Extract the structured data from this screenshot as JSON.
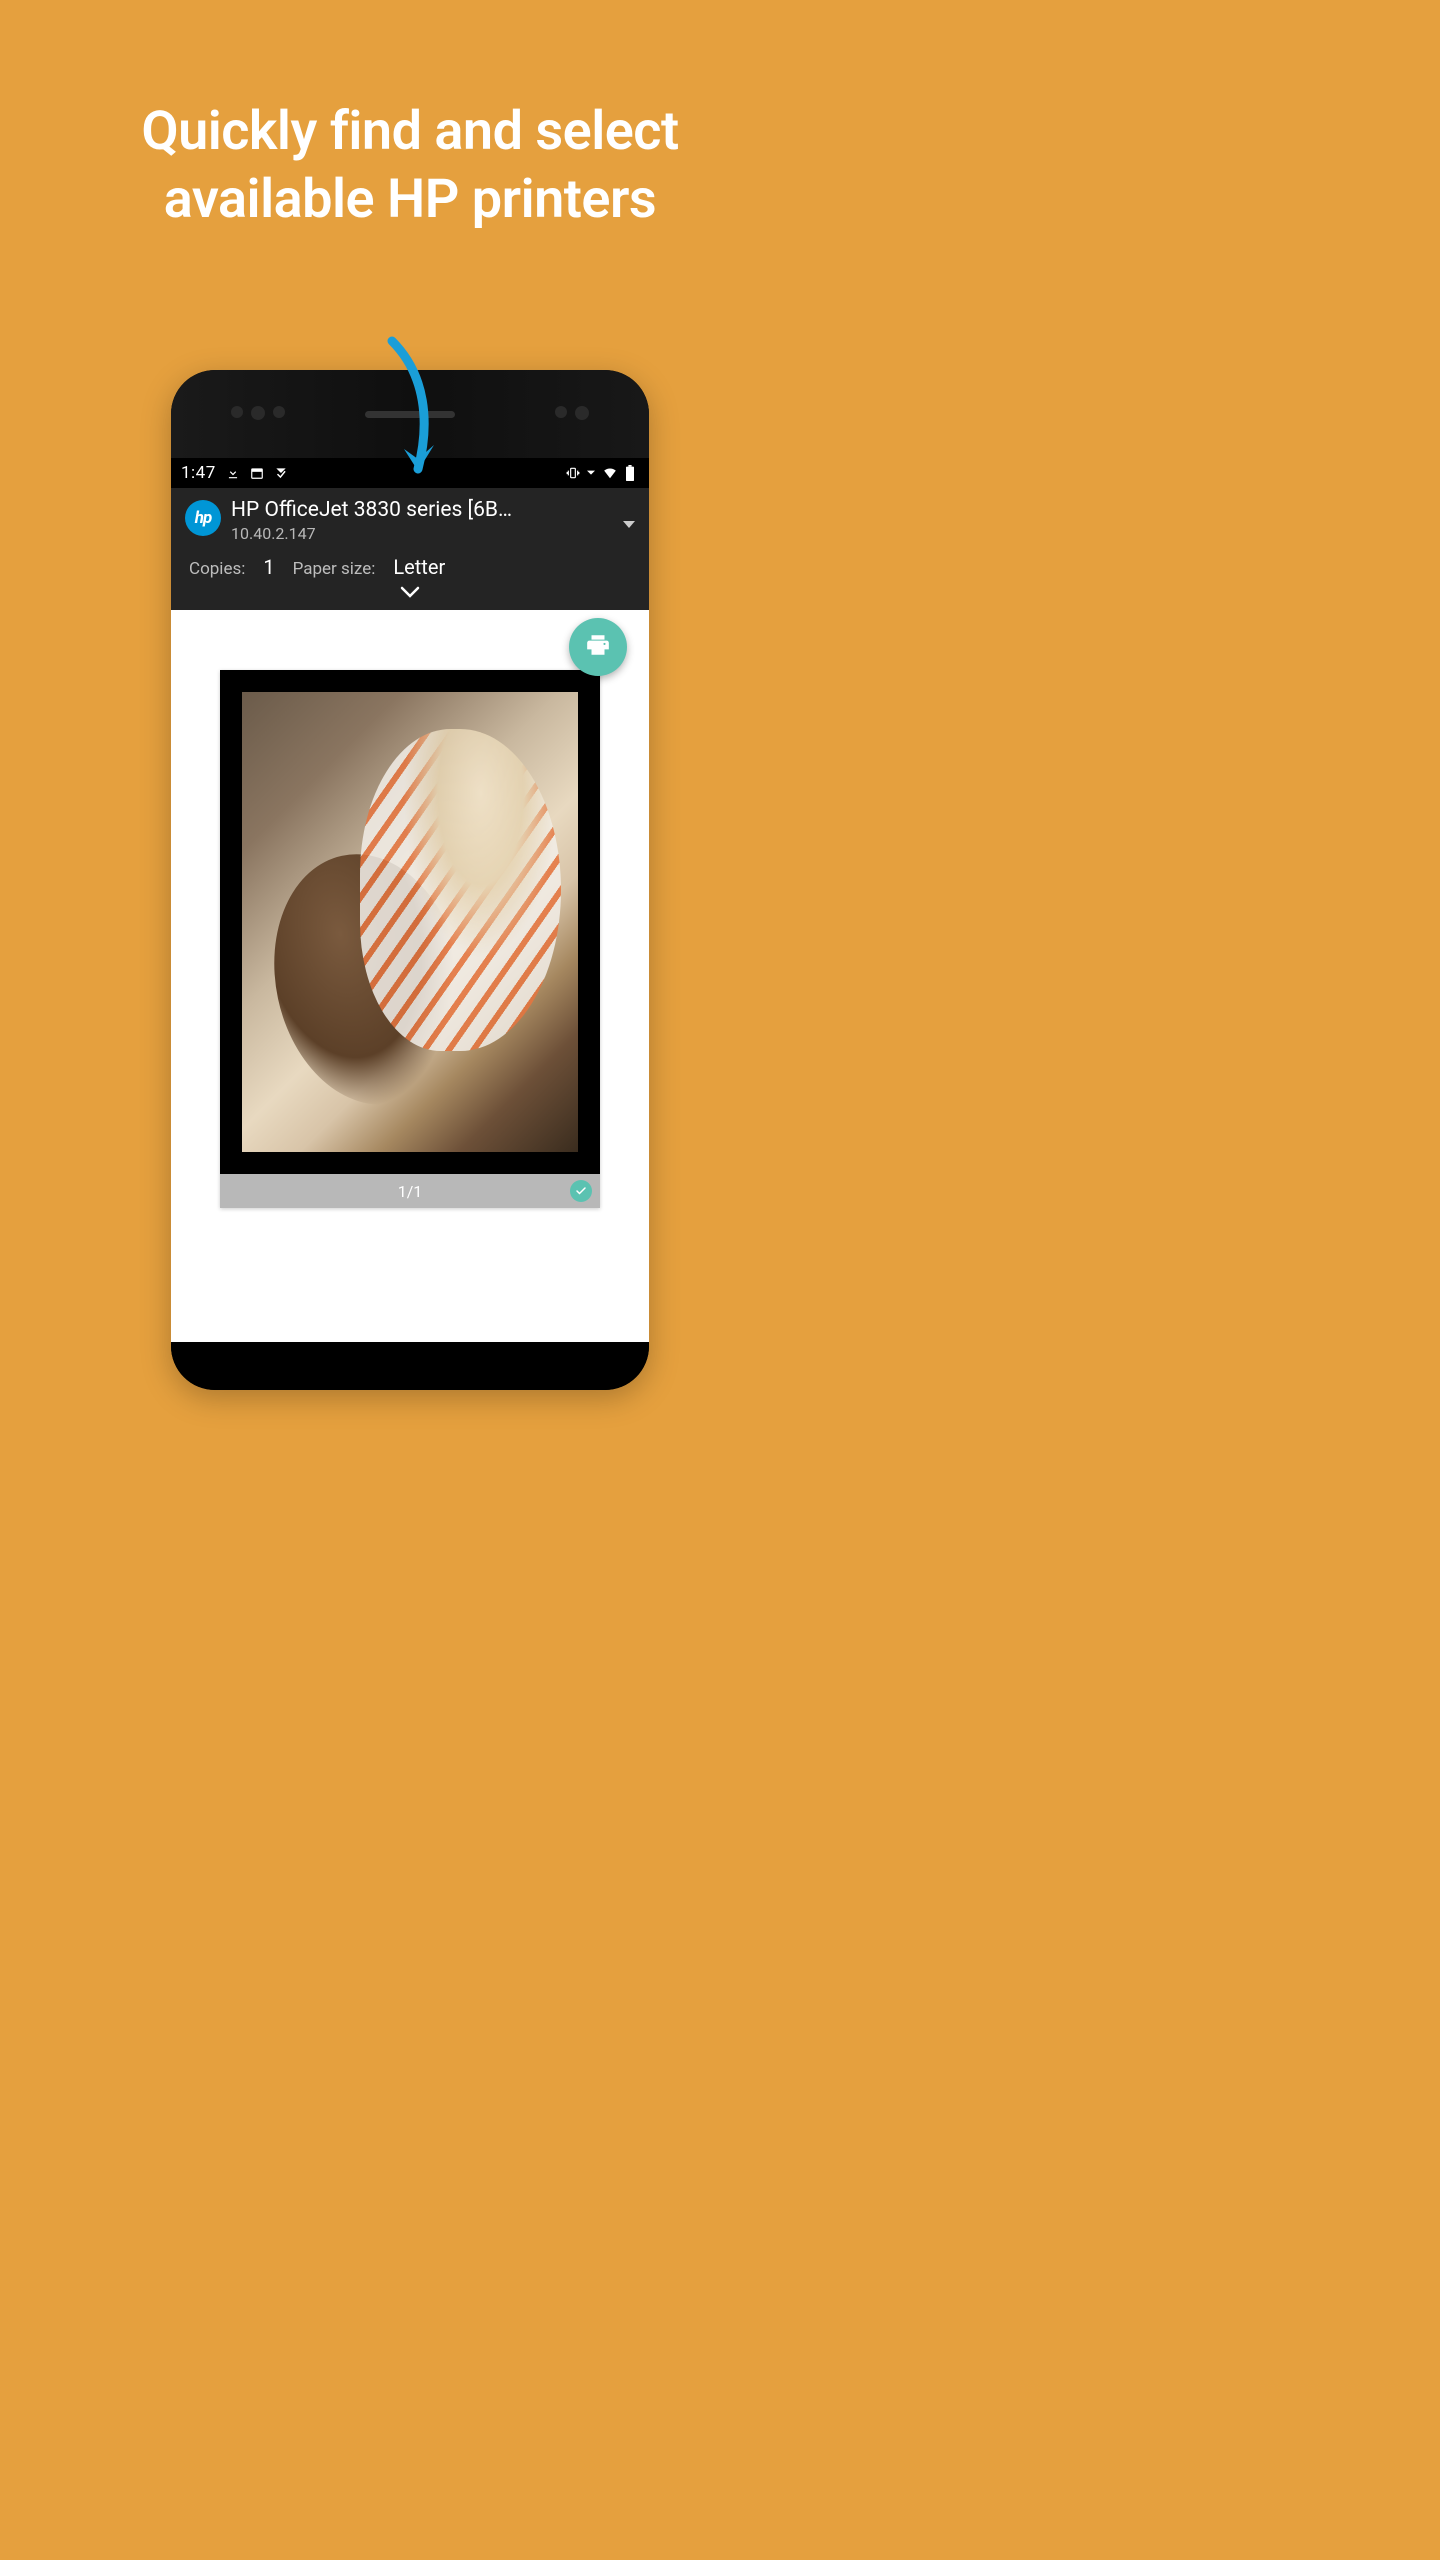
{
  "headline_line1": "Quickly find and select",
  "headline_line2": "available HP printers",
  "status": {
    "time": "1:47"
  },
  "printer": {
    "logo_text": "hp",
    "name": "HP OfficeJet 3830 series [6B…",
    "ip": "10.40.2.147"
  },
  "settings": {
    "copies_label": "Copies:",
    "copies_value": "1",
    "paper_label": "Paper size:",
    "paper_value": "Letter"
  },
  "preview": {
    "page_counter": "1/1"
  }
}
